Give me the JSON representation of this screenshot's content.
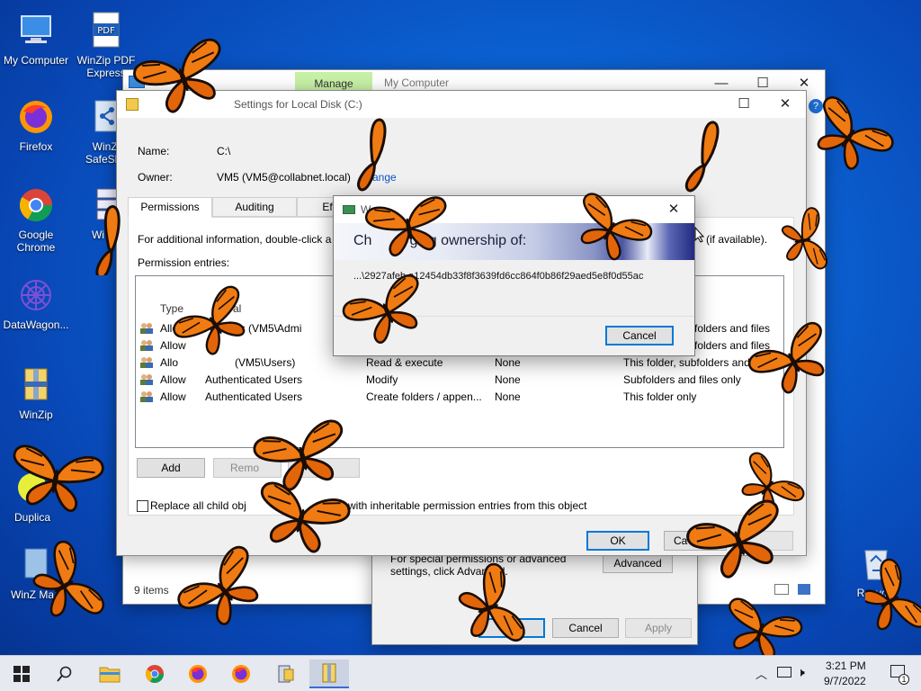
{
  "desktop": {
    "icons": [
      {
        "label": "My Computer"
      },
      {
        "label": "WinZip PDF Express"
      },
      {
        "label": "Firefox"
      },
      {
        "label": "WinZi SafeSha"
      },
      {
        "label": "Google Chrome"
      },
      {
        "label": "Wi Se"
      },
      {
        "label": "DataWagon..."
      },
      {
        "label": "WinZip"
      },
      {
        "label": "Duplica"
      },
      {
        "label": "WinZ Ma"
      },
      {
        "label": "Recycle"
      }
    ]
  },
  "explorer": {
    "manage_tab": "Manage",
    "title": "My Computer",
    "status": "9 items"
  },
  "advsec": {
    "title": "Advanced Security Settings for Local Disk (C:)",
    "title_visible": "Settings for Local Disk (C:)",
    "name_label": "Name:",
    "name_value": "C:\\",
    "owner_label": "Owner:",
    "owner_value": "VM5 (VM5@collabnet.local)",
    "change_link": "ange",
    "tabs": [
      {
        "label": "Permissions"
      },
      {
        "label": "Auditing"
      },
      {
        "label": "Effecti"
      }
    ],
    "info_text": "For additional information, double-click a",
    "info_tail": "(if available).",
    "entries_label": "Permission entries:",
    "columns": {
      "type": "Type",
      "principal": "al"
    },
    "rows": [
      {
        "type": "Allow",
        "principal": "Ad   ators (VM5\\Admi",
        "access": "",
        "inherited": "",
        "applies": "folders and files"
      },
      {
        "type": "Allow",
        "principal": "",
        "access": "",
        "inherited": "",
        "applies": "folders and files"
      },
      {
        "type": "Allo",
        "principal": "(VM5\\Users)",
        "access": "Read & execute",
        "inherited": "None",
        "applies": "This folder, subfolders and fil"
      },
      {
        "type": "Allow",
        "principal": "Authenticated Users",
        "access": "Modify",
        "inherited": "None",
        "applies": "Subfolders and files only"
      },
      {
        "type": "Allow",
        "principal": "Authenticated Users",
        "access": "Create folders / appen...",
        "inherited": "None",
        "applies": "This folder only"
      }
    ],
    "add_button": "Add",
    "remove_button": "Remo",
    "replace_checkbox_label_left": "Replace all child obj",
    "replace_checkbox_label_right": "es with inheritable permission entries from this object",
    "ok_button": "OK",
    "cancel_button": "Ca"
  },
  "diskprops": {
    "text": "For special permissions or advanced settings, click Advanced.",
    "advanced_button": "Advanced",
    "ok_button": "OK",
    "cancel_button": "Cancel",
    "apply_button": "Apply"
  },
  "progress": {
    "title_initial": "W",
    "heading": "Changing ownership of:",
    "heading_visible_left": "Ch",
    "heading_visible_right": "ging ownership of:",
    "path": "...\\2927afeb   a12454db33f8f3639fd6cc864f0b86f29aed5e8f0d55ac",
    "cancel_button": "Cancel"
  },
  "taskbar": {
    "time": "3:21 PM",
    "date": "9/7/2022",
    "notification_count": "1"
  },
  "colors": {
    "butterfly_orange": "#f07b12",
    "butterfly_black": "#1a0d06",
    "manage_tab": "#c7f1a6",
    "accent": "#0078d7"
  }
}
